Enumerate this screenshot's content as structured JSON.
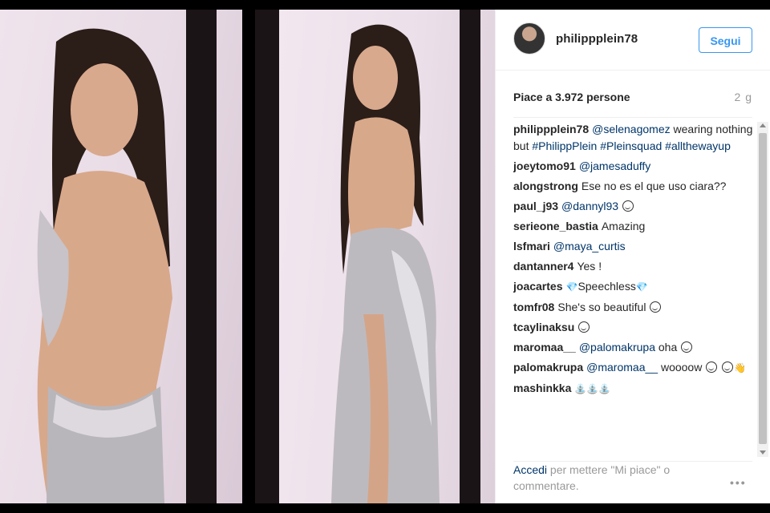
{
  "post": {
    "username": "philippplein78",
    "follow_label": "Segui",
    "likes": "Piace a 3.972 persone",
    "time": "2 g",
    "more_icon": "more-options-icon"
  },
  "comments": [
    {
      "user": "philippplein78",
      "parts": [
        {
          "t": "@selenagomez",
          "k": "mention"
        },
        {
          "t": " wearing nothing but "
        },
        {
          "t": "#PhilippPlein",
          "k": "tag"
        },
        {
          "t": " "
        },
        {
          "t": "#Pleinsquad",
          "k": "tag"
        },
        {
          "t": " "
        },
        {
          "t": "#allthewayup",
          "k": "tag"
        }
      ]
    },
    {
      "user": "joeytomo91",
      "parts": [
        {
          "t": "@jamesaduffy",
          "k": "mention"
        }
      ]
    },
    {
      "user": "alongstrong",
      "parts": [
        {
          "t": "Ese no es el que uso ciara??"
        }
      ]
    },
    {
      "user": "paul_j93",
      "parts": [
        {
          "t": "@dannyl93",
          "k": "mention"
        },
        {
          "t": " "
        },
        {
          "t": "",
          "k": "emoji"
        }
      ]
    },
    {
      "user": "serieone_bastia",
      "parts": [
        {
          "t": "Amazing"
        }
      ]
    },
    {
      "user": "lsfmari",
      "parts": [
        {
          "t": "@maya_curtis",
          "k": "mention"
        }
      ]
    },
    {
      "user": "dantanner4",
      "parts": [
        {
          "t": "Yes !"
        }
      ]
    },
    {
      "user": "joacartes",
      "parts": [
        {
          "t": "💎",
          "k": "glyph"
        },
        {
          "t": "Speechless"
        },
        {
          "t": "💎",
          "k": "glyph"
        }
      ]
    },
    {
      "user": "tomfr08",
      "parts": [
        {
          "t": "She's so beautiful "
        },
        {
          "t": "",
          "k": "emoji"
        }
      ]
    },
    {
      "user": "tcaylinaksu",
      "parts": [
        {
          "t": "",
          "k": "emoji"
        }
      ]
    },
    {
      "user": "maromaa__",
      "parts": [
        {
          "t": "@palomakrupa",
          "k": "mention"
        },
        {
          "t": " oha "
        },
        {
          "t": "",
          "k": "emoji"
        }
      ]
    },
    {
      "user": "palomakrupa",
      "parts": [
        {
          "t": "@maromaa__",
          "k": "mention"
        },
        {
          "t": " woooow "
        },
        {
          "t": "",
          "k": "emoji"
        },
        {
          "t": " "
        },
        {
          "t": "",
          "k": "emoji"
        },
        {
          "t": "👋",
          "k": "glyph"
        }
      ]
    },
    {
      "user": "mashinkka",
      "parts": [
        {
          "t": "⛲⛲⛲",
          "k": "glyph"
        }
      ]
    }
  ],
  "login": {
    "link": "Accedi",
    "rest": " per mettere \"Mi piace\" o commentare."
  },
  "colors": {
    "accent": "#3897f0",
    "link": "#003569",
    "muted": "#999999",
    "text": "#262626"
  }
}
